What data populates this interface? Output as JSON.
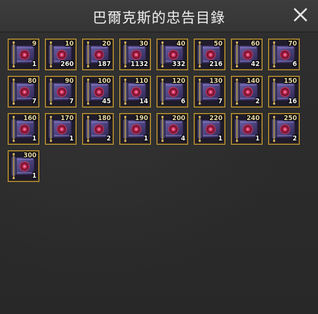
{
  "window": {
    "title": "巴爾克斯的忠告目錄",
    "close_icon": "close-icon"
  },
  "colors": {
    "slot_border": "#c9a13c",
    "scroll_purple": "#4a3f7a",
    "seal_red": "#8a1c3c"
  },
  "slots": [
    {
      "level": "9",
      "count": "1"
    },
    {
      "level": "10",
      "count": "260"
    },
    {
      "level": "20",
      "count": "187"
    },
    {
      "level": "30",
      "count": "1132"
    },
    {
      "level": "40",
      "count": "332"
    },
    {
      "level": "50",
      "count": "216"
    },
    {
      "level": "60",
      "count": "42"
    },
    {
      "level": "70",
      "count": "6"
    },
    {
      "level": "80",
      "count": "7"
    },
    {
      "level": "90",
      "count": "7"
    },
    {
      "level": "100",
      "count": "45"
    },
    {
      "level": "110",
      "count": "14"
    },
    {
      "level": "120",
      "count": "6"
    },
    {
      "level": "130",
      "count": "7"
    },
    {
      "level": "140",
      "count": "2"
    },
    {
      "level": "150",
      "count": "16"
    },
    {
      "level": "160",
      "count": "1"
    },
    {
      "level": "170",
      "count": "1"
    },
    {
      "level": "180",
      "count": "2"
    },
    {
      "level": "190",
      "count": "1"
    },
    {
      "level": "200",
      "count": "4"
    },
    {
      "level": "220",
      "count": "1"
    },
    {
      "level": "240",
      "count": "1"
    },
    {
      "level": "250",
      "count": "2"
    },
    {
      "level": "300",
      "count": "1"
    }
  ]
}
